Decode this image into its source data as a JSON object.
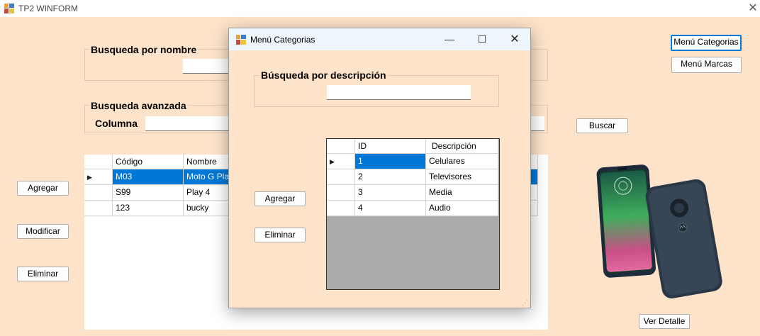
{
  "window": {
    "title": "TP2 WINFORM"
  },
  "search_by_name": {
    "title": "Busqueda por nombre",
    "value": ""
  },
  "advanced_search": {
    "title": "Busqueda avanzada",
    "column_label": "Columna",
    "column_value": ""
  },
  "buttons": {
    "menu_categorias": "Menú Categorias",
    "menu_marcas": "Menú Marcas",
    "buscar": "Buscar",
    "agregar": "Agregar",
    "modificar": "Modificar",
    "eliminar": "Eliminar",
    "ver_detalle": "Ver Detalle"
  },
  "articles_grid": {
    "columns": [
      "Código",
      "Nombre"
    ],
    "rows": [
      {
        "codigo": "M03",
        "nombre": "Moto G Play",
        "selected": true
      },
      {
        "codigo": "S99",
        "nombre": "Play 4",
        "selected": false
      },
      {
        "codigo": "123",
        "nombre": "bucky",
        "selected": false
      }
    ]
  },
  "dialog": {
    "title": "Menú Categorias",
    "search_title": "Búsqueda por descripción",
    "search_value": "",
    "buttons": {
      "agregar": "Agregar",
      "eliminar": "Eliminar"
    },
    "grid": {
      "columns": [
        "ID",
        "Descripción"
      ],
      "rows": [
        {
          "id": "1",
          "descripcion": "Celulares",
          "selected": true
        },
        {
          "id": "2",
          "descripcion": "Televisores",
          "selected": false
        },
        {
          "id": "3",
          "descripcion": "Media",
          "selected": false
        },
        {
          "id": "4",
          "descripcion": "Audio",
          "selected": false
        }
      ]
    }
  },
  "icons": {
    "app": "winform-app-icon",
    "close": "close-icon",
    "minimize": "minimize-icon",
    "maximize": "maximize-icon",
    "row_pointer": "row-pointer-icon"
  },
  "colors": {
    "form_bg": "#fde3c9",
    "selection": "#0078d7",
    "header_selected": "#cce8ff"
  }
}
